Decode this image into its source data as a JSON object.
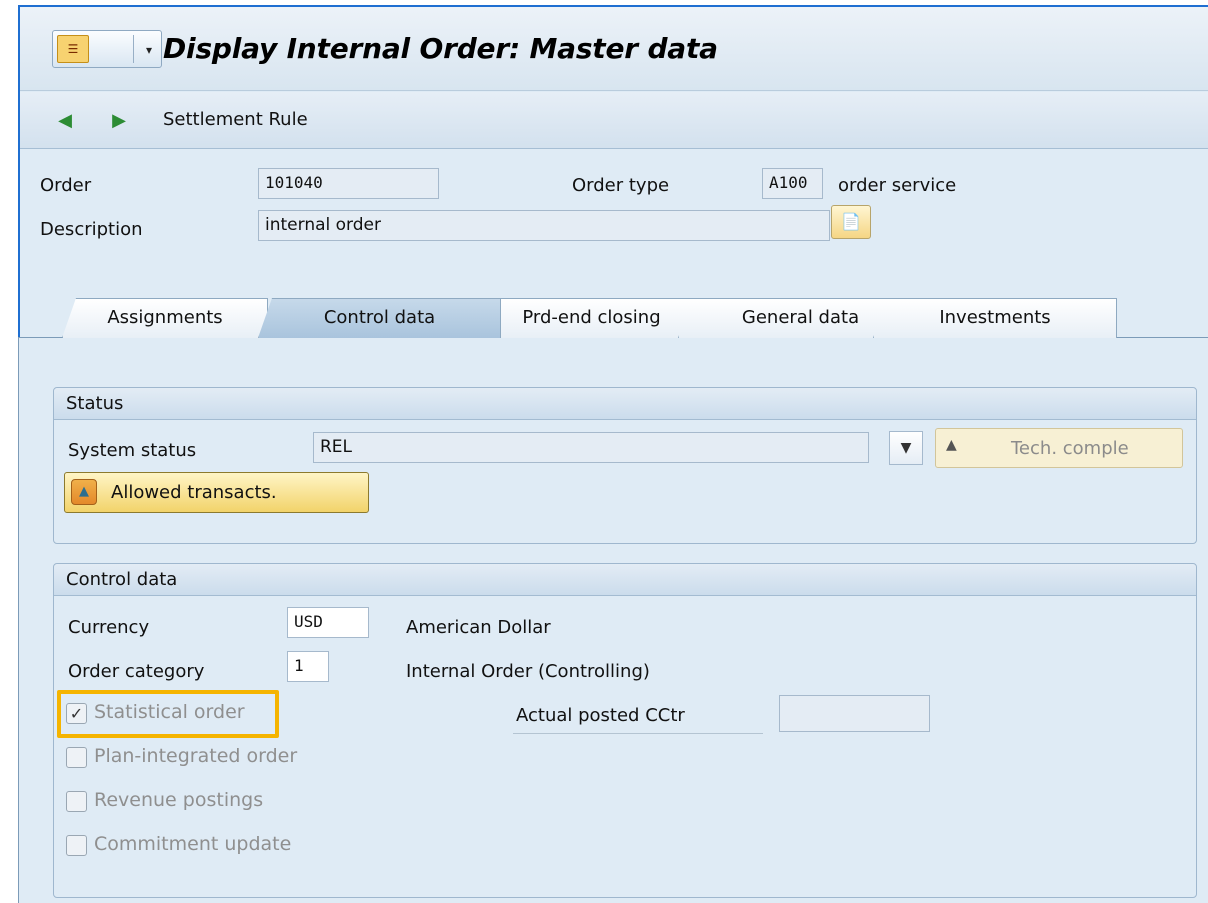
{
  "window": {
    "title": "Display Internal Order: Master data",
    "menu_icon": "sap-menu-icon"
  },
  "toolbar": {
    "settlement_rule_label": "Settlement Rule",
    "icons": [
      "previous-icon",
      "next-icon"
    ]
  },
  "header": {
    "order_label": "Order",
    "order_value": "101040",
    "order_type_label": "Order type",
    "order_type_value": "A100",
    "order_type_text": "order service",
    "description_label": "Description",
    "description_value": "internal order"
  },
  "tabs": [
    {
      "label": "Assignments",
      "active": false
    },
    {
      "label": "Control data",
      "active": true
    },
    {
      "label": "Prd-end closing",
      "active": false
    },
    {
      "label": "General data",
      "active": false
    },
    {
      "label": "Investments",
      "active": false
    }
  ],
  "status_group": {
    "title": "Status",
    "system_status_label": "System status",
    "system_status_value": "REL",
    "tech_complete_label": "Tech. comple",
    "allowed_transacts_label": "Allowed transacts."
  },
  "control_group": {
    "title": "Control data",
    "currency_label": "Currency",
    "currency_value": "USD",
    "currency_text": "American Dollar",
    "order_category_label": "Order category",
    "order_category_value": "1",
    "order_category_text": "Internal Order (Controlling)",
    "actual_posted_cctr_label": "Actual posted CCtr",
    "actual_posted_cctr_value": "",
    "checkboxes": [
      {
        "label": "Statistical order",
        "checked": true
      },
      {
        "label": "Plan-integrated order",
        "checked": false
      },
      {
        "label": "Revenue postings",
        "checked": false
      },
      {
        "label": "Commitment update",
        "checked": false
      }
    ]
  },
  "colors": {
    "highlight": "#f5b400",
    "frame_border": "#1f6fd1"
  }
}
